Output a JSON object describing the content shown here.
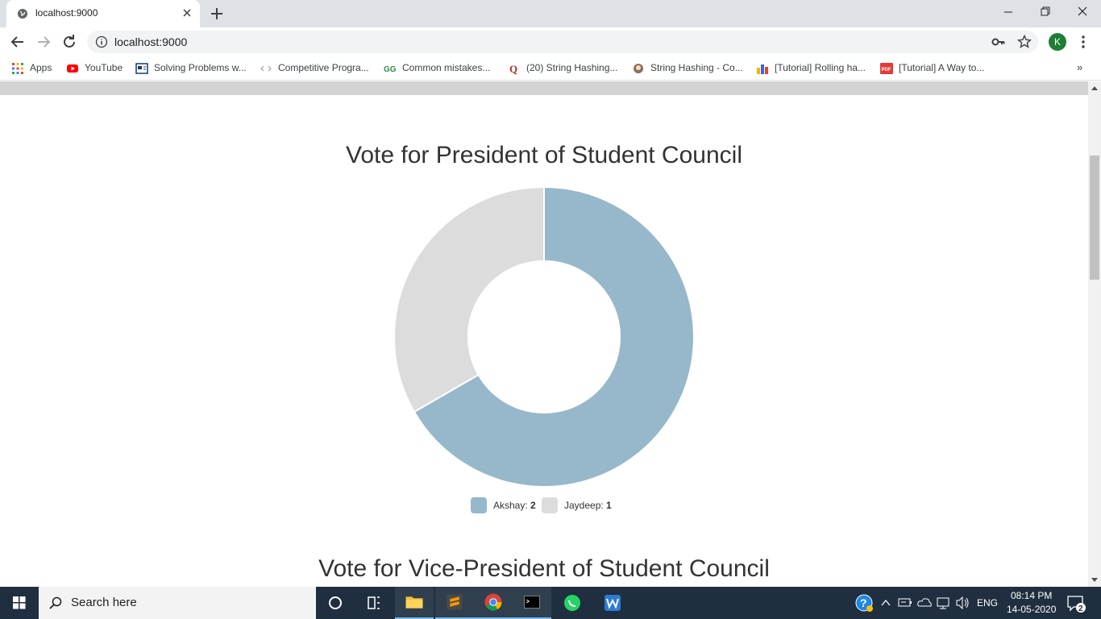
{
  "browser": {
    "tab_title": "localhost:9000",
    "url": "localhost:9000",
    "profile_initial": "K"
  },
  "bookmarks": [
    {
      "label": "Apps",
      "icon": "apps-grid-icon"
    },
    {
      "label": "YouTube",
      "icon": "youtube-icon"
    },
    {
      "label": "Solving Problems w...",
      "icon": "image-icon"
    },
    {
      "label": "Competitive Progra...",
      "icon": "code-arrows-icon"
    },
    {
      "label": "Common mistakes...",
      "icon": "geeksforgeeks-icon"
    },
    {
      "label": "(20) String Hashing...",
      "icon": "quora-icon"
    },
    {
      "label": "String Hashing - Co...",
      "icon": "cp-algorithms-icon"
    },
    {
      "label": "[Tutorial] Rolling ha...",
      "icon": "codeforces-icon"
    },
    {
      "label": "[Tutorial] A Way to...",
      "icon": "pdf-icon"
    }
  ],
  "page": {
    "chart1_title": "Vote for President of Student Council",
    "chart2_title": "Vote for Vice-President of Student Council"
  },
  "chart_data": [
    {
      "type": "pie",
      "title": "Vote for President of Student Council",
      "categories": [
        "Akshay",
        "Jaydeep"
      ],
      "values": [
        2,
        1
      ],
      "colors": [
        "#97b8cb",
        "#dcdcdc"
      ],
      "legend": "bottom",
      "legend_items": [
        {
          "label": "Akshay:",
          "value": "2"
        },
        {
          "label": "Jaydeep:",
          "value": "1"
        }
      ]
    }
  ],
  "taskbar": {
    "search_placeholder": "Search here",
    "language": "ENG",
    "time": "08:14 PM",
    "date": "14-05-2020",
    "notifications_count": "2"
  }
}
